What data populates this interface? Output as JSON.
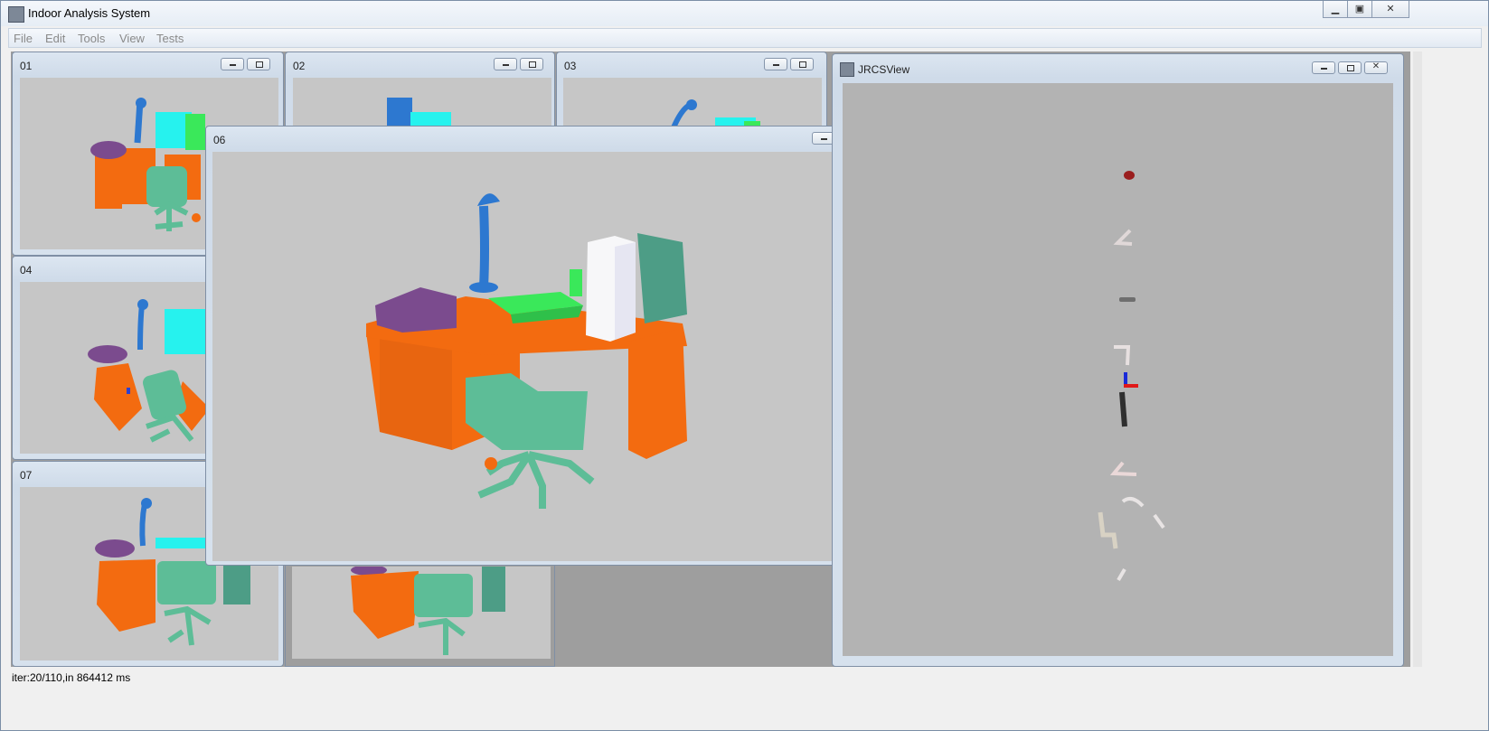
{
  "app": {
    "title": "Indoor Analysis System",
    "window_min": "▭",
    "window_max": "▭",
    "window_close": "✕"
  },
  "menu": [
    {
      "label": "File"
    },
    {
      "label": "Edit"
    },
    {
      "label": "Tools"
    },
    {
      "label": "View"
    },
    {
      "label": "Tests"
    }
  ],
  "subwindows": {
    "w01": {
      "title": "01"
    },
    "w02": {
      "title": "02"
    },
    "w03": {
      "title": "03"
    },
    "w04": {
      "title": "04"
    },
    "w06": {
      "title": "06"
    },
    "w07": {
      "title": "07"
    },
    "jrcs": {
      "title": "JRCSView"
    }
  },
  "status": {
    "text": "iter:20/110,in 864412 ms"
  },
  "colors": {
    "desk": "#f36b10",
    "chair": "#5dbd97",
    "lamp": "#2d78d0",
    "pillow": "#7b4b8e",
    "monitor": "#26f2ee",
    "keyboard": "#3ae85a",
    "cabinet": "#4d9d86",
    "box": "#f7f7f9",
    "view_bg": "#c6c6c6",
    "jrcs_bg": "#b3b3b3"
  }
}
